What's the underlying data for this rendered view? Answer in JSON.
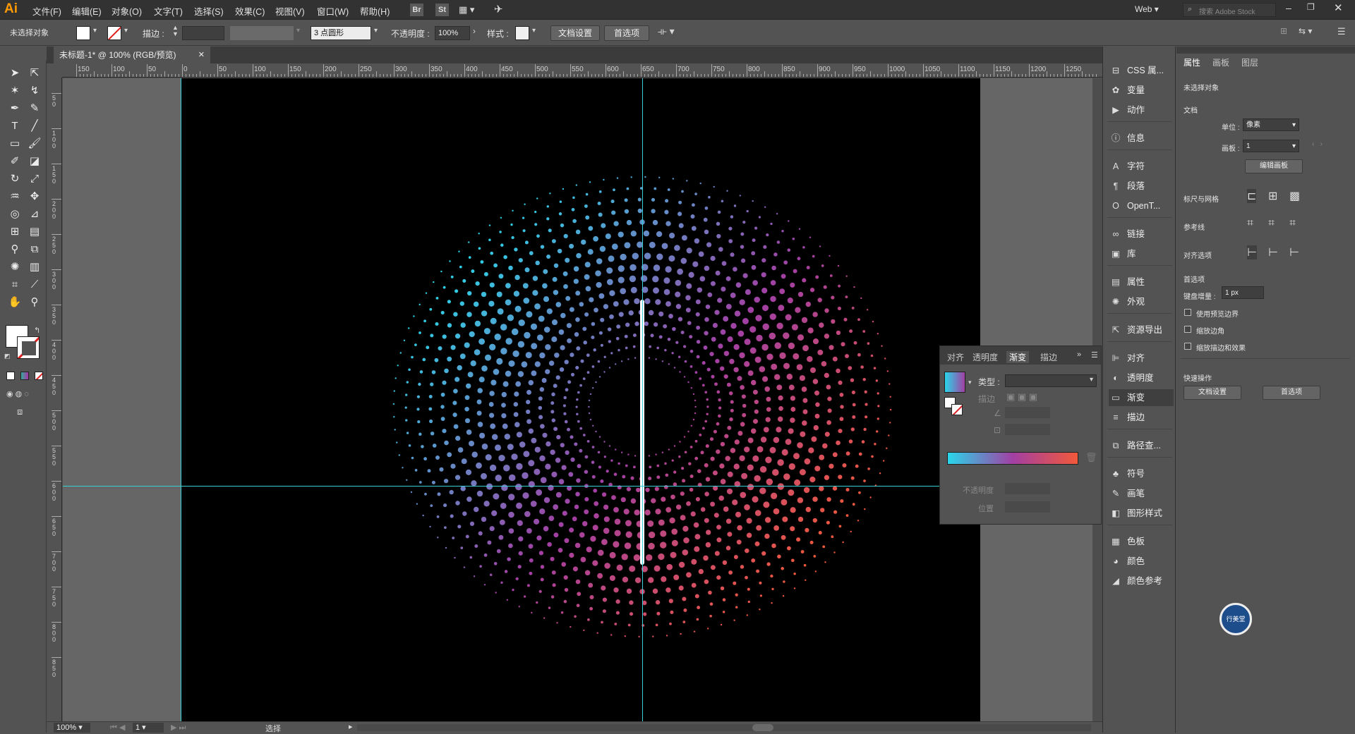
{
  "menubar": {
    "logo": "Ai",
    "items": [
      "文件(F)",
      "编辑(E)",
      "对象(O)",
      "文字(T)",
      "选择(S)",
      "效果(C)",
      "视图(V)",
      "窗口(W)",
      "帮助(H)"
    ],
    "tags": [
      "Br",
      "St"
    ],
    "workspace": "Web",
    "search_placeholder": "搜索 Adobe Stock"
  },
  "control": {
    "selection": "未选择对象",
    "stroke_label": "描边 :",
    "brush": "3 点圆形",
    "opacity_label": "不透明度 :",
    "opacity_value": "100%",
    "style_label": "样式 :",
    "doc_setup": "文档设置",
    "prefs": "首选项"
  },
  "document": {
    "tab_title": "未标题-1* @ 100% (RGB/预览)",
    "ruler_labels": [
      "150",
      "100",
      "50",
      "0",
      "50",
      "100",
      "150",
      "200",
      "250",
      "300",
      "350",
      "400",
      "450",
      "500",
      "550",
      "600",
      "650",
      "700",
      "750",
      "800",
      "850",
      "900",
      "950",
      "1000",
      "1050",
      "1100",
      "1150",
      "1200",
      "1250"
    ],
    "vruler_labels": [
      "5 0",
      "1 0 0",
      "1 5 0",
      "2 0 0",
      "2 5 0",
      "3 0 0",
      "3 5 0",
      "4 0 0",
      "4 5 0",
      "5 0 0",
      "5 5 0",
      "6 0 0",
      "6 5 0",
      "7 0 0",
      "7 5 0",
      "8 0 0",
      "8 5 0"
    ]
  },
  "status": {
    "zoom": "100%",
    "page": "1",
    "mode": "选择"
  },
  "icon_panel": {
    "items": [
      {
        "label": "CSS 属...",
        "icon": "css-icon"
      },
      {
        "label": "变量",
        "icon": "variables-icon"
      },
      {
        "label": "动作",
        "icon": "actions-icon"
      },
      {
        "label": "信息",
        "icon": "info-icon"
      },
      {
        "label": "字符",
        "icon": "character-icon"
      },
      {
        "label": "段落",
        "icon": "paragraph-icon"
      },
      {
        "label": "OpenT...",
        "icon": "opentype-icon"
      },
      {
        "label": "链接",
        "icon": "links-icon"
      },
      {
        "label": "库",
        "icon": "libraries-icon"
      },
      {
        "label": "属性",
        "icon": "properties-icon"
      },
      {
        "label": "外观",
        "icon": "appearance-icon"
      },
      {
        "label": "资源导出",
        "icon": "asset-export-icon"
      },
      {
        "label": "对齐",
        "icon": "align-icon"
      },
      {
        "label": "透明度",
        "icon": "transparency-icon"
      },
      {
        "label": "渐变",
        "icon": "gradient-icon"
      },
      {
        "label": "描边",
        "icon": "stroke-icon"
      },
      {
        "label": "路径查...",
        "icon": "pathfinder-icon"
      },
      {
        "label": "符号",
        "icon": "symbols-icon"
      },
      {
        "label": "画笔",
        "icon": "brushes-icon"
      },
      {
        "label": "图形样式",
        "icon": "graphic-styles-icon"
      },
      {
        "label": "色板",
        "icon": "swatches-icon"
      },
      {
        "label": "颜色",
        "icon": "color-icon"
      },
      {
        "label": "颜色参考",
        "icon": "color-guide-icon"
      }
    ]
  },
  "properties": {
    "tabs": [
      "属性",
      "画板",
      "图层"
    ],
    "no_selection": "未选择对象",
    "doc_section": "文档",
    "unit_label": "单位 :",
    "unit_value": "像素",
    "artboard_label": "画板 :",
    "artboard_value": "1",
    "edit_artboards": "编辑画板",
    "rulers_grid": "标尺与网格",
    "guides": "参考线",
    "snap": "对齐选项",
    "prefs_section": "首选项",
    "keyboard_inc_label": "键盘增量 :",
    "keyboard_inc": "1 px",
    "chk1": "使用预览边界",
    "chk2": "缩放边角",
    "chk3": "缩放描边和效果",
    "quick_actions": "快速操作",
    "doc_setup": "文档设置",
    "prefs": "首选项"
  },
  "gradient_panel": {
    "tabs": [
      "对齐",
      "透明度",
      "渐变",
      "描边"
    ],
    "type_label": "类型 :",
    "stroke_label": "描边",
    "opacity_label": "不透明度",
    "position_label": "位置"
  },
  "badge": {
    "text": "行美堂"
  },
  "colors": {
    "grad_start": "#29d6ea",
    "grad_mid": "#a23fa3",
    "grad_end": "#f2593a",
    "guide": "#39d0d3"
  }
}
